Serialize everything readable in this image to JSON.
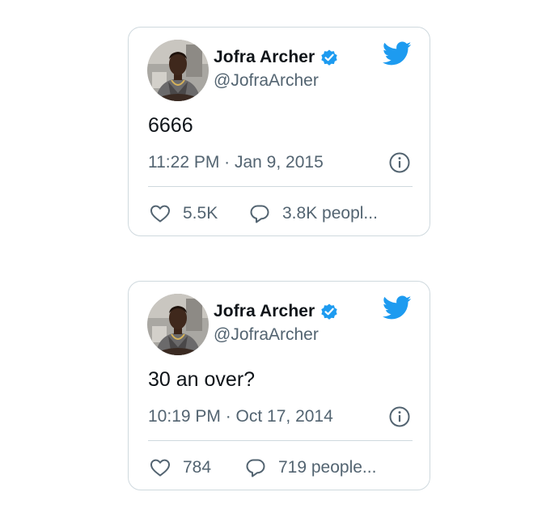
{
  "tweets": [
    {
      "display_name": "Jofra Archer",
      "handle": "@JofraArcher",
      "text": "6666",
      "timestamp": "11:22 PM · Jan 9, 2015",
      "likes": "5.5K",
      "replies": "3.8K peopl..."
    },
    {
      "display_name": "Jofra Archer",
      "handle": "@JofraArcher",
      "text": "30 an over?",
      "timestamp": "10:19 PM · Oct 17, 2014",
      "likes": "784",
      "replies": "719 people..."
    }
  ],
  "icons": {
    "verified": "verified-badge-icon",
    "brand": "twitter-bird-icon",
    "info": "info-icon",
    "like": "heart-icon",
    "reply": "speech-bubble-icon"
  },
  "colors": {
    "brand_blue": "#1d9bf0",
    "text_primary": "#0f1419",
    "text_secondary": "#536471",
    "border": "#cfd9de"
  }
}
